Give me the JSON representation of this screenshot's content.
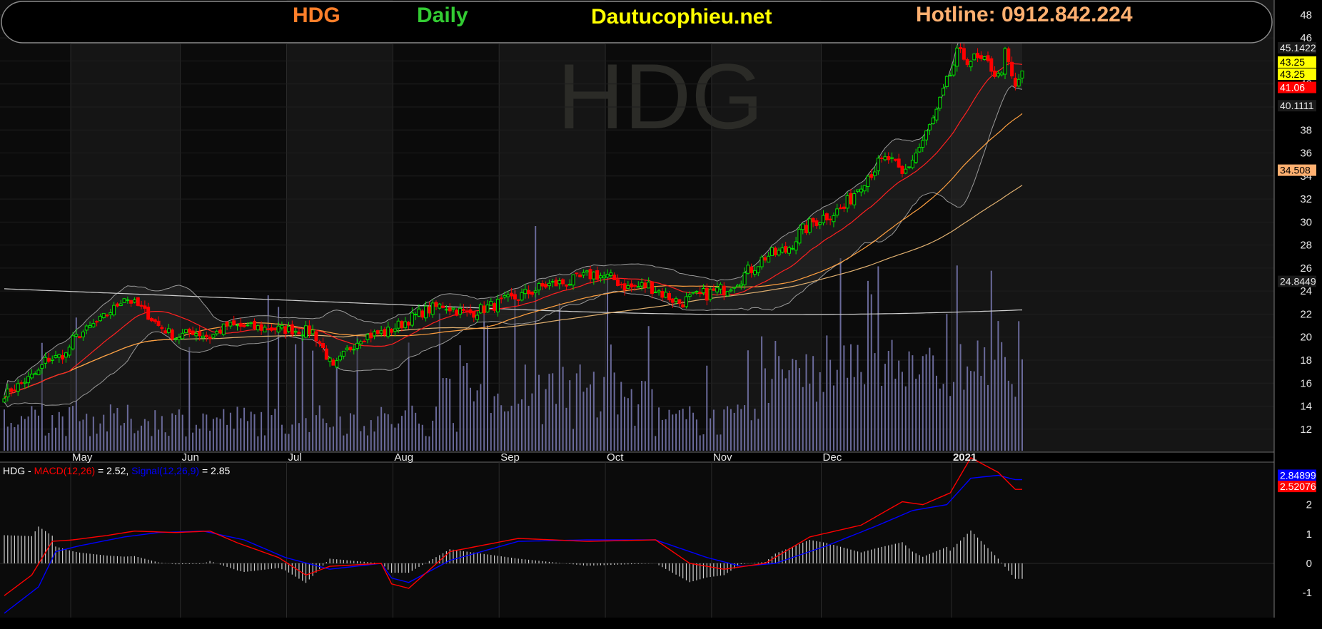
{
  "header": {
    "symbol": "HDG",
    "period": "Daily",
    "site": "Dautucophieu.net",
    "hotline": "Hotline: 0912.842.224"
  },
  "watermark": "HDG",
  "colors": {
    "symbol": "#ff7f2a",
    "period": "#33cc33",
    "site": "#ffff00",
    "hotline": "#ffb070",
    "up_candle": "#00e000",
    "down_candle": "#ff0000",
    "ma_fast": "#ff2020",
    "ma_mid": "#ffa040",
    "ma_slow": "#e0b070",
    "ma_long": "#d0d0d0",
    "volume": "#6a6a9a",
    "bollinger": "#9a9a9a",
    "macd": "#ff0000",
    "signal": "#0000ff"
  },
  "chart_data": [
    {
      "type": "candlestick",
      "title": "HDG",
      "x_labels": [
        "May",
        "Jun",
        "Jul",
        "Aug",
        "Sep",
        "Oct",
        "Nov",
        "Dec",
        "2021"
      ],
      "y_ticks": [
        12,
        14,
        16,
        18,
        20,
        22,
        24,
        26,
        28,
        30,
        32,
        34,
        36,
        38,
        40,
        42,
        44,
        46,
        48
      ],
      "ylim": [
        10.5,
        48.8
      ],
      "price_keypoints": [
        [
          0,
          15
        ],
        [
          10,
          17
        ],
        [
          12,
          18
        ],
        [
          18,
          18.5
        ],
        [
          20,
          19.8
        ],
        [
          28,
          21.5
        ],
        [
          32,
          22.5
        ],
        [
          35,
          23.5
        ],
        [
          40,
          22.5
        ],
        [
          45,
          21
        ],
        [
          50,
          20
        ],
        [
          55,
          20.5
        ],
        [
          60,
          20
        ],
        [
          65,
          21
        ],
        [
          75,
          20.8
        ],
        [
          90,
          20.5
        ],
        [
          93,
          19
        ],
        [
          96,
          17.2
        ],
        [
          100,
          18.8
        ],
        [
          104,
          20
        ],
        [
          112,
          20.5
        ],
        [
          122,
          22.2
        ],
        [
          128,
          22.8
        ],
        [
          135,
          22
        ],
        [
          140,
          22.5
        ],
        [
          150,
          23.5
        ],
        [
          158,
          24.5
        ],
        [
          165,
          24.8
        ],
        [
          172,
          25.5
        ],
        [
          178,
          25
        ],
        [
          182,
          24.3
        ],
        [
          188,
          24.5
        ],
        [
          192,
          23.8
        ],
        [
          197,
          23
        ],
        [
          203,
          23.6
        ],
        [
          210,
          24.2
        ],
        [
          215,
          25.2
        ],
        [
          222,
          27
        ],
        [
          228,
          27.5
        ],
        [
          232,
          29
        ],
        [
          236,
          30
        ],
        [
          240,
          30.6
        ],
        [
          245,
          31.2
        ],
        [
          250,
          33.5
        ],
        [
          255,
          35
        ],
        [
          258,
          35.5
        ],
        [
          262,
          34
        ],
        [
          265,
          35.5
        ],
        [
          268,
          37
        ],
        [
          272,
          39.5
        ],
        [
          275,
          42
        ],
        [
          278,
          44.5
        ],
        [
          284,
          44
        ],
        [
          288,
          43.5
        ],
        [
          290,
          42.5
        ],
        [
          292,
          44.5
        ],
        [
          295,
          41.5
        ],
        [
          297,
          43.2
        ]
      ],
      "annotations": {
        "bb_upper_last": "45.1422",
        "close": "43.25",
        "open": "43.25",
        "low_tag": "41.06",
        "bb_lower_last": "40.1111",
        "ma_mid_last": "34.508",
        "ma_long_last": "24.8449"
      }
    },
    {
      "type": "line",
      "title": "HDG - MACD(12,26) = 2.52, Signal(12,26,9) = 2.85",
      "label_prefix": "HDG - ",
      "macd_label": "MACD(12,26)",
      "macd_value_text": " = 2.52, ",
      "signal_label": "Signal(12,26,9)",
      "signal_value_text": " = 2.85",
      "y_ticks": [
        -1,
        0,
        1,
        2
      ],
      "ylim": [
        -1.75,
        3.4
      ],
      "series": [
        {
          "name": "MACD(12,26)",
          "keypoints": [
            [
              0,
              -1.1
            ],
            [
              8,
              -0.4
            ],
            [
              14,
              0.75
            ],
            [
              20,
              0.8
            ],
            [
              30,
              0.95
            ],
            [
              38,
              1.1
            ],
            [
              50,
              1.05
            ],
            [
              60,
              1.1
            ],
            [
              68,
              0.7
            ],
            [
              80,
              0.2
            ],
            [
              88,
              -0.4
            ],
            [
              95,
              -0.1
            ],
            [
              110,
              0
            ],
            [
              113,
              -0.7
            ],
            [
              118,
              -0.85
            ],
            [
              130,
              0.4
            ],
            [
              150,
              0.85
            ],
            [
              170,
              0.75
            ],
            [
              190,
              0.8
            ],
            [
              200,
              0.0
            ],
            [
              210,
              -0.2
            ],
            [
              222,
              0.0
            ],
            [
              235,
              0.9
            ],
            [
              250,
              1.3
            ],
            [
              262,
              2.1
            ],
            [
              268,
              2.0
            ],
            [
              276,
              2.4
            ],
            [
              282,
              3.6
            ],
            [
              290,
              3.1
            ],
            [
              295,
              2.52
            ]
          ]
        },
        {
          "name": "Signal(12,26,9)",
          "keypoints": [
            [
              0,
              -1.7
            ],
            [
              10,
              -0.8
            ],
            [
              15,
              0.4
            ],
            [
              22,
              0.6
            ],
            [
              35,
              0.9
            ],
            [
              45,
              1.05
            ],
            [
              58,
              1.1
            ],
            [
              70,
              0.8
            ],
            [
              82,
              0.2
            ],
            [
              95,
              -0.2
            ],
            [
              110,
              0
            ],
            [
              113,
              -0.5
            ],
            [
              118,
              -0.65
            ],
            [
              130,
              0.1
            ],
            [
              150,
              0.75
            ],
            [
              170,
              0.8
            ],
            [
              190,
              0.8
            ],
            [
              205,
              0.2
            ],
            [
              215,
              -0.1
            ],
            [
              225,
              0
            ],
            [
              240,
              0.6
            ],
            [
              255,
              1.3
            ],
            [
              265,
              1.8
            ],
            [
              275,
              2.0
            ],
            [
              282,
              2.9
            ],
            [
              290,
              3.0
            ],
            [
              295,
              2.85
            ]
          ]
        }
      ],
      "tags": {
        "signal_last": "2.84899",
        "macd_last": "2.52076"
      }
    }
  ]
}
